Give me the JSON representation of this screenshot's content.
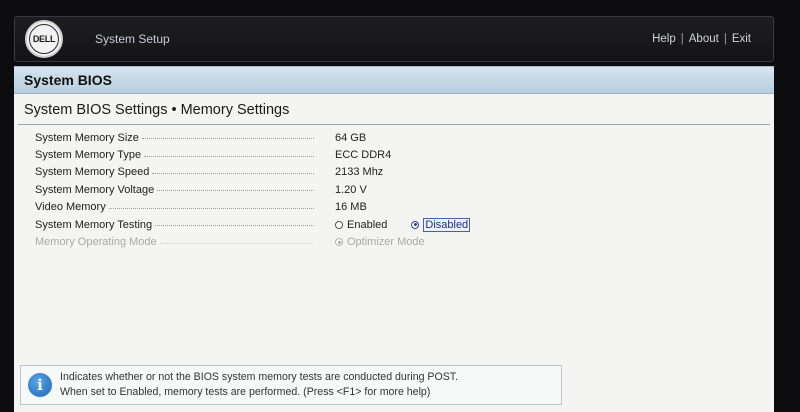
{
  "header": {
    "logo_text": "DELL",
    "app_title": "System Setup",
    "nav": {
      "help": "Help",
      "about": "About",
      "exit": "Exit",
      "separator": "|"
    }
  },
  "section_title": "System BIOS",
  "page_title": "System BIOS Settings • Memory Settings",
  "settings": [
    {
      "label": "System Memory Size",
      "value": "64 GB"
    },
    {
      "label": "System Memory Type",
      "value": "ECC DDR4"
    },
    {
      "label": "System Memory Speed",
      "value": "2133 Mhz"
    },
    {
      "label": "System Memory Voltage",
      "value": "1.20 V"
    },
    {
      "label": "Video Memory",
      "value": "16 MB"
    }
  ],
  "memory_testing": {
    "label": "System Memory Testing",
    "option_enabled": "Enabled",
    "option_disabled": "Disabled",
    "selected": "Disabled"
  },
  "operating_mode": {
    "label": "Memory Operating Mode",
    "option": "Optimizer Mode"
  },
  "help": {
    "line1": "Indicates whether or not the BIOS system memory tests are conducted during POST.",
    "line2": "When set to Enabled, memory tests are performed. (Press <F1> for more help)"
  },
  "colors": {
    "section_bar": "#c4d7e5",
    "focus_blue": "#2b3fa8",
    "info_blue": "#1d64b4"
  }
}
